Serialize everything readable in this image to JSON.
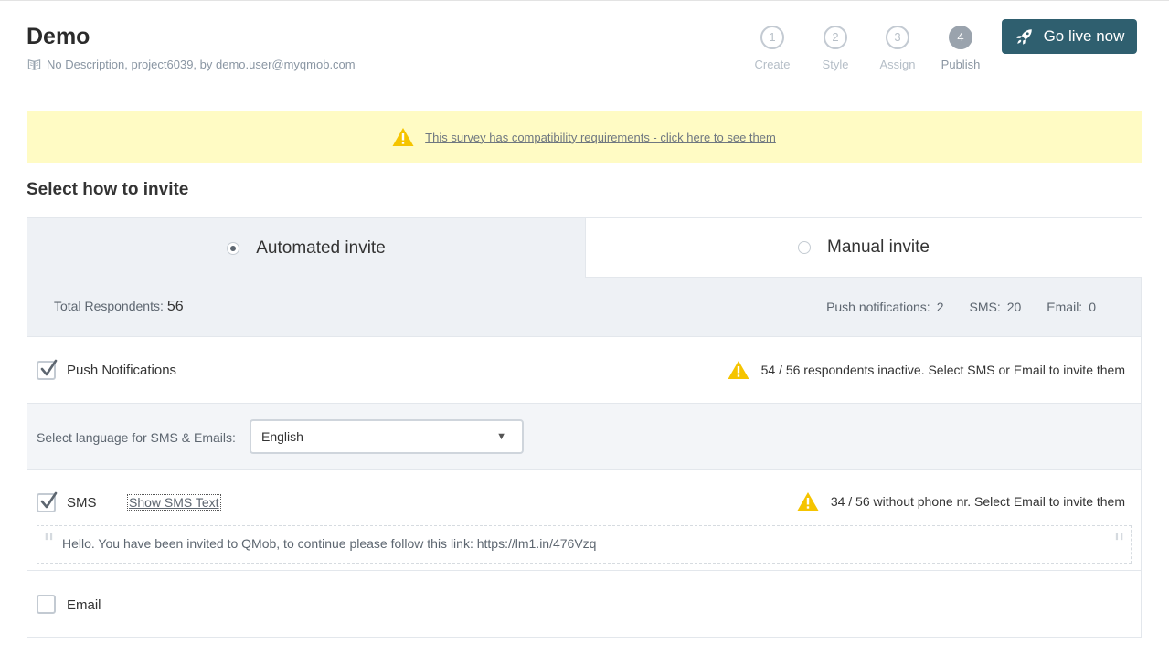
{
  "header": {
    "title": "Demo",
    "subtitle": "No Description, project6039, by demo.user@myqmob.com",
    "subtitle_icon": "book-icon"
  },
  "steps": [
    {
      "number": "1",
      "label": "Create",
      "active": false
    },
    {
      "number": "2",
      "label": "Style",
      "active": false
    },
    {
      "number": "3",
      "label": "Assign",
      "active": false
    },
    {
      "number": "4",
      "label": "Publish",
      "active": true
    }
  ],
  "go_live": {
    "label": "Go live now",
    "icon": "rocket-icon",
    "color": "#2f5f6f"
  },
  "banner": {
    "text": "This survey has compatibility requirements - click here to see them",
    "icon": "warning-icon",
    "background": "#fffbc4"
  },
  "invite": {
    "heading": "Select how to invite",
    "tabs": [
      {
        "label": "Automated invite",
        "selected": true
      },
      {
        "label": "Manual invite",
        "selected": false
      }
    ],
    "stats": {
      "total_label": "Total Respondents:",
      "total_value": "56",
      "push_label": "Push notifications:",
      "push_value": "2",
      "sms_label": "SMS:",
      "sms_value": "20",
      "email_label": "Email:",
      "email_value": "0"
    }
  },
  "channels": {
    "push": {
      "label": "Push Notifications",
      "checked": true,
      "notice": "54 / 56 respondents inactive. Select SMS or Email to invite them"
    },
    "language": {
      "label": "Select language for SMS & Emails:",
      "selected": "English"
    },
    "sms": {
      "label": "SMS",
      "checked": true,
      "show_text_link": "Show SMS Text",
      "notice": "34 / 56 without phone nr. Select Email to invite them",
      "message": "Hello. You have been invited to QMob, to continue please follow this link: https://lm1.in/476Vzq"
    },
    "email": {
      "label": "Email",
      "checked": false
    }
  }
}
